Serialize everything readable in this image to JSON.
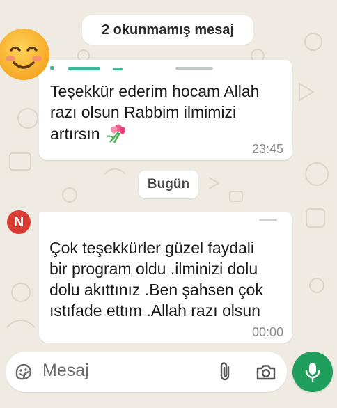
{
  "banner": {
    "unread_label": "2 okunmamış mesaj"
  },
  "messages": [
    {
      "avatar": "smiling-face-emoji",
      "text": "Teşekkür ederim hocam Allah\nrazı olsun Rabbim ilmimizi\nartırsın",
      "emoji": "tulip-bouquet",
      "time": "23:45"
    },
    {
      "avatar_letter": "N",
      "text": "Çok teşekkürler güzel faydali\nbir program oldu .ilminizi dolu\ndolu akıttınız  .Ben şahsen çok\nıstıfade ettım .Allah razı olsun",
      "time": "00:00"
    }
  ],
  "date_separator": "Bugün",
  "composer": {
    "placeholder": "Mesaj",
    "icons": [
      "sticker-icon",
      "paperclip-icon",
      "camera-icon",
      "microphone-icon"
    ]
  },
  "colors": {
    "wallpaper": "#efeae2",
    "bubble": "#ffffff",
    "mic_button": "#1f9e5c",
    "avatar_n": "#d93a32"
  }
}
